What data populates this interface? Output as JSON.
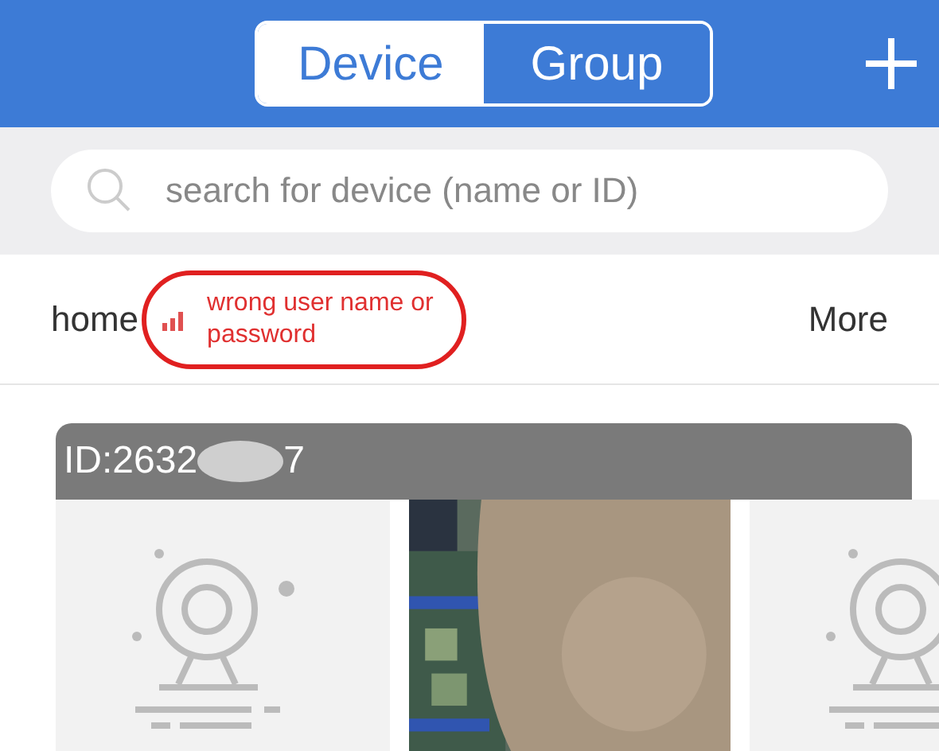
{
  "tabs": [
    {
      "label": "Device",
      "selected": true
    },
    {
      "label": "Group",
      "selected": false
    }
  ],
  "search": {
    "placeholder": "search for device (name or ID)"
  },
  "group": {
    "name": "home",
    "error": "wrong user name or password",
    "more": "More"
  },
  "device": {
    "id_start": "ID:2632",
    "id_end": "7"
  },
  "thumbnails": [
    {
      "kind": "placeholder"
    },
    {
      "kind": "picture"
    },
    {
      "kind": "placeholder"
    }
  ]
}
